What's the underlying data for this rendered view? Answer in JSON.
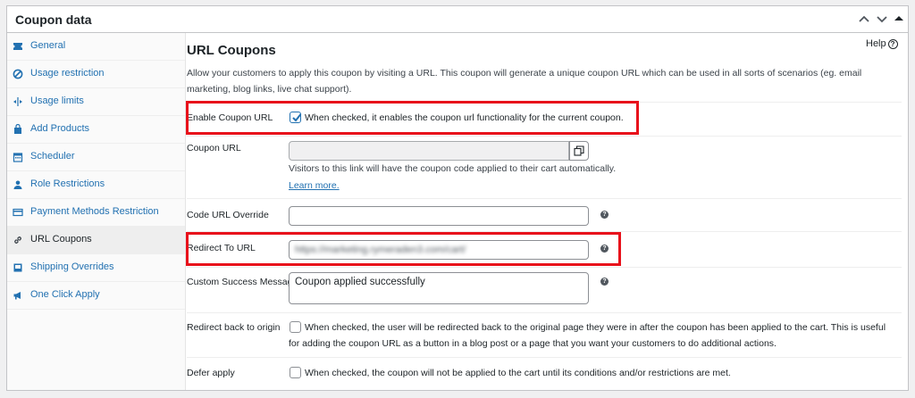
{
  "panel": {
    "title": "Coupon data"
  },
  "sidebar": {
    "items": [
      {
        "label": "General",
        "icon": "ticket-icon"
      },
      {
        "label": "Usage restriction",
        "icon": "block-icon"
      },
      {
        "label": "Usage limits",
        "icon": "limits-icon"
      },
      {
        "label": "Add Products",
        "icon": "cart-icon"
      },
      {
        "label": "Scheduler",
        "icon": "calendar-icon"
      },
      {
        "label": "Role Restrictions",
        "icon": "user-icon"
      },
      {
        "label": "Payment Methods Restriction",
        "icon": "card-icon"
      },
      {
        "label": "URL Coupons",
        "icon": "link-icon"
      },
      {
        "label": "Shipping Overrides",
        "icon": "shipping-icon"
      },
      {
        "label": "One Click Apply",
        "icon": "megaphone-icon"
      }
    ],
    "active": "URL Coupons"
  },
  "main": {
    "title": "URL Coupons",
    "help": "Help",
    "description": "Allow your customers to apply this coupon by visiting a URL. This coupon will generate a unique coupon URL which can be used in all sorts of scenarios (eg. email marketing, blog links, live chat support).",
    "enable": {
      "label": "Enable Coupon URL",
      "text": "When checked, it enables the coupon url functionality for the current coupon.",
      "checked": true
    },
    "coupon_url": {
      "label": "Coupon URL",
      "value": "",
      "hint": "Visitors to this link will have the coupon code applied to their cart automatically.",
      "learn_more": "Learn more."
    },
    "code_override": {
      "label": "Code URL Override",
      "value": ""
    },
    "redirect": {
      "label": "Redirect To URL",
      "value": "https://marketing.rymeraden3.com/cart/"
    },
    "success_message": {
      "label": "Custom Success Message",
      "value": "Coupon applied successfully"
    },
    "redirect_origin": {
      "label": "Redirect back to origin",
      "line1": "When checked, the user will be redirected back to the original page they were in after the coupon has been applied to the cart. This is useful",
      "line2": "for adding the coupon URL as a button in a blog post or a page that you want your customers to do additional actions.",
      "checked": false
    },
    "defer": {
      "label": "Defer apply",
      "text": "When checked, the coupon will not be applied to the cart until its conditions and/or restrictions are met.",
      "checked": false
    }
  },
  "colors": {
    "highlight": "#e8111b",
    "link": "#2271b1",
    "checkbox": "#2271b1"
  }
}
